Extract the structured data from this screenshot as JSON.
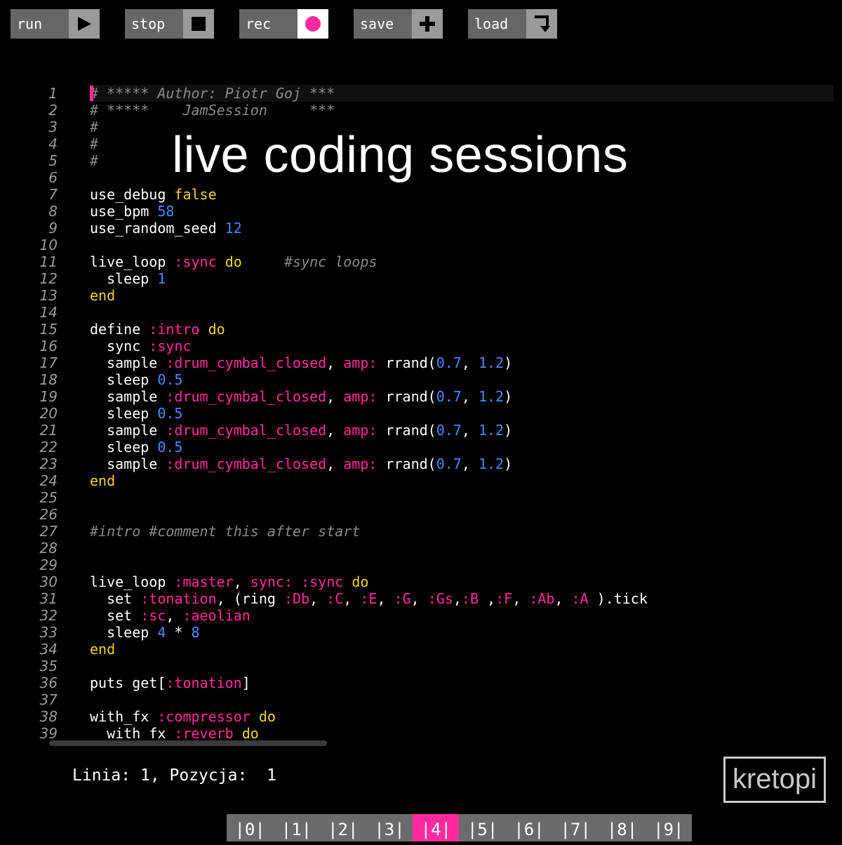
{
  "toolbar": {
    "buttons": [
      {
        "label": "run",
        "icon": "play-icon"
      },
      {
        "label": "stop",
        "icon": "stop-icon"
      },
      {
        "label": "rec",
        "icon": "record-icon"
      },
      {
        "label": "save",
        "icon": "plus-icon"
      },
      {
        "label": "load",
        "icon": "load-icon"
      }
    ]
  },
  "overlay_title": "live coding sessions",
  "editor": {
    "lines": [
      [
        [
          "cm",
          "# ***** Author: Piotr Goj ***"
        ]
      ],
      [
        [
          "cm",
          "# *****    JamSession     ***"
        ]
      ],
      [
        [
          "cm",
          "#"
        ]
      ],
      [
        [
          "cm",
          "#"
        ]
      ],
      [
        [
          "cm",
          "#"
        ]
      ],
      [],
      [
        [
          "pl",
          "use_debug "
        ],
        [
          "kw",
          "false"
        ]
      ],
      [
        [
          "pl",
          "use_bpm "
        ],
        [
          "num",
          "58"
        ]
      ],
      [
        [
          "pl",
          "use_random_seed "
        ],
        [
          "num",
          "12"
        ]
      ],
      [],
      [
        [
          "pl",
          "live_loop "
        ],
        [
          "sym",
          ":sync"
        ],
        [
          "pl",
          " "
        ],
        [
          "kw",
          "do"
        ],
        [
          "pl",
          "     "
        ],
        [
          "cm",
          "#sync loops"
        ]
      ],
      [
        [
          "pl",
          "  sleep "
        ],
        [
          "num",
          "1"
        ]
      ],
      [
        [
          "kw",
          "end"
        ]
      ],
      [],
      [
        [
          "pl",
          "define "
        ],
        [
          "sym",
          ":intro"
        ],
        [
          "pl",
          " "
        ],
        [
          "kw",
          "do"
        ]
      ],
      [
        [
          "pl",
          "  sync "
        ],
        [
          "sym",
          ":sync"
        ]
      ],
      [
        [
          "pl",
          "  sample "
        ],
        [
          "sym",
          ":drum_cymbal_closed"
        ],
        [
          "pl",
          ", "
        ],
        [
          "sym",
          "amp:"
        ],
        [
          "pl",
          " rrand("
        ],
        [
          "num",
          "0.7"
        ],
        [
          "pl",
          ", "
        ],
        [
          "num",
          "1.2"
        ],
        [
          "pl",
          ")"
        ]
      ],
      [
        [
          "pl",
          "  sleep "
        ],
        [
          "num",
          "0.5"
        ]
      ],
      [
        [
          "pl",
          "  sample "
        ],
        [
          "sym",
          ":drum_cymbal_closed"
        ],
        [
          "pl",
          ", "
        ],
        [
          "sym",
          "amp:"
        ],
        [
          "pl",
          " rrand("
        ],
        [
          "num",
          "0.7"
        ],
        [
          "pl",
          ", "
        ],
        [
          "num",
          "1.2"
        ],
        [
          "pl",
          ")"
        ]
      ],
      [
        [
          "pl",
          "  sleep "
        ],
        [
          "num",
          "0.5"
        ]
      ],
      [
        [
          "pl",
          "  sample "
        ],
        [
          "sym",
          ":drum_cymbal_closed"
        ],
        [
          "pl",
          ", "
        ],
        [
          "sym",
          "amp:"
        ],
        [
          "pl",
          " rrand("
        ],
        [
          "num",
          "0.7"
        ],
        [
          "pl",
          ", "
        ],
        [
          "num",
          "1.2"
        ],
        [
          "pl",
          ")"
        ]
      ],
      [
        [
          "pl",
          "  sleep "
        ],
        [
          "num",
          "0.5"
        ]
      ],
      [
        [
          "pl",
          "  sample "
        ],
        [
          "sym",
          ":drum_cymbal_closed"
        ],
        [
          "pl",
          ", "
        ],
        [
          "sym",
          "amp:"
        ],
        [
          "pl",
          " rrand("
        ],
        [
          "num",
          "0.7"
        ],
        [
          "pl",
          ", "
        ],
        [
          "num",
          "1.2"
        ],
        [
          "pl",
          ")"
        ]
      ],
      [
        [
          "kw",
          "end"
        ]
      ],
      [],
      [],
      [
        [
          "cm",
          "#intro #comment this after start"
        ]
      ],
      [],
      [],
      [
        [
          "pl",
          "live_loop "
        ],
        [
          "sym",
          ":master"
        ],
        [
          "pl",
          ", "
        ],
        [
          "sym",
          "sync:"
        ],
        [
          "pl",
          " "
        ],
        [
          "sym",
          ":sync"
        ],
        [
          "pl",
          " "
        ],
        [
          "kw",
          "do"
        ]
      ],
      [
        [
          "pl",
          "  set "
        ],
        [
          "sym",
          ":tonation"
        ],
        [
          "pl",
          ", (ring "
        ],
        [
          "sym",
          ":Db"
        ],
        [
          "pl",
          ", "
        ],
        [
          "sym",
          ":C"
        ],
        [
          "pl",
          ", "
        ],
        [
          "sym",
          ":E"
        ],
        [
          "pl",
          ", "
        ],
        [
          "sym",
          ":G"
        ],
        [
          "pl",
          ", "
        ],
        [
          "sym",
          ":Gs"
        ],
        [
          "pl",
          ","
        ],
        [
          "sym",
          ":B"
        ],
        [
          "pl",
          " ,"
        ],
        [
          "sym",
          ":F"
        ],
        [
          "pl",
          ", "
        ],
        [
          "sym",
          ":Ab"
        ],
        [
          "pl",
          ", "
        ],
        [
          "sym",
          ":A"
        ],
        [
          "pl",
          " ).tick"
        ]
      ],
      [
        [
          "pl",
          "  set "
        ],
        [
          "sym",
          ":sc"
        ],
        [
          "pl",
          ", "
        ],
        [
          "sym",
          ":aeolian"
        ]
      ],
      [
        [
          "pl",
          "  sleep "
        ],
        [
          "num",
          "4"
        ],
        [
          "pl",
          " * "
        ],
        [
          "num",
          "8"
        ]
      ],
      [
        [
          "kw",
          "end"
        ]
      ],
      [],
      [
        [
          "pl",
          "puts get["
        ],
        [
          "sym",
          ":tonation"
        ],
        [
          "pl",
          "]"
        ]
      ],
      [],
      [
        [
          "pl",
          "with_fx "
        ],
        [
          "sym",
          ":compressor"
        ],
        [
          "pl",
          " "
        ],
        [
          "kw",
          "do"
        ]
      ],
      [
        [
          "pl",
          "  with_fx "
        ],
        [
          "sym",
          ":reverb"
        ],
        [
          "pl",
          " "
        ],
        [
          "kw",
          "do"
        ]
      ]
    ]
  },
  "status": {
    "line_label": "Linia:",
    "line": "1",
    "pos_label": "Pozycja:",
    "pos": "1"
  },
  "logo": "kretopi",
  "tabs": [
    "|0|",
    "|1|",
    "|2|",
    "|3|",
    "|4|",
    "|5|",
    "|6|",
    "|7|",
    "|8|",
    "|9|"
  ],
  "active_tab": 4,
  "colors": {
    "accent": "#ff2a9d",
    "keyword": "#f2d31b",
    "number": "#4f86f7",
    "comment": "#8a8a8a"
  }
}
